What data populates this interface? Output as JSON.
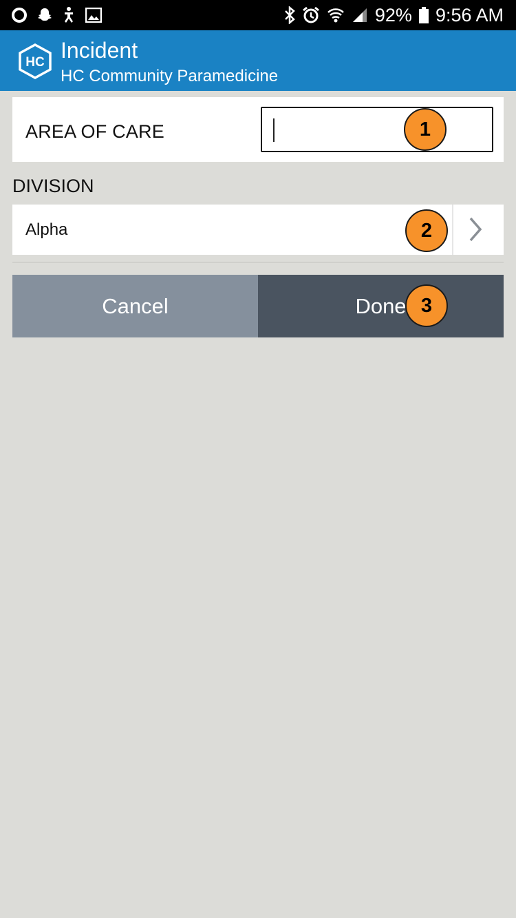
{
  "status_bar": {
    "battery": "92%",
    "time": "9:56 AM"
  },
  "app_bar": {
    "logo_text": "HC",
    "title": "Incident",
    "subtitle": "HC Community Paramedicine"
  },
  "form": {
    "area_of_care": {
      "label": "AREA OF CARE",
      "value": ""
    },
    "division": {
      "label": "DIVISION",
      "value": "Alpha"
    }
  },
  "buttons": {
    "cancel": "Cancel",
    "done": "Done"
  },
  "markers": [
    "1",
    "2",
    "3"
  ],
  "colors": {
    "app_bar": "#1a82c4",
    "marker": "#f7922a",
    "cancel_button": "#85909d",
    "done_button": "#4a5460",
    "background": "#dcdcd8"
  }
}
